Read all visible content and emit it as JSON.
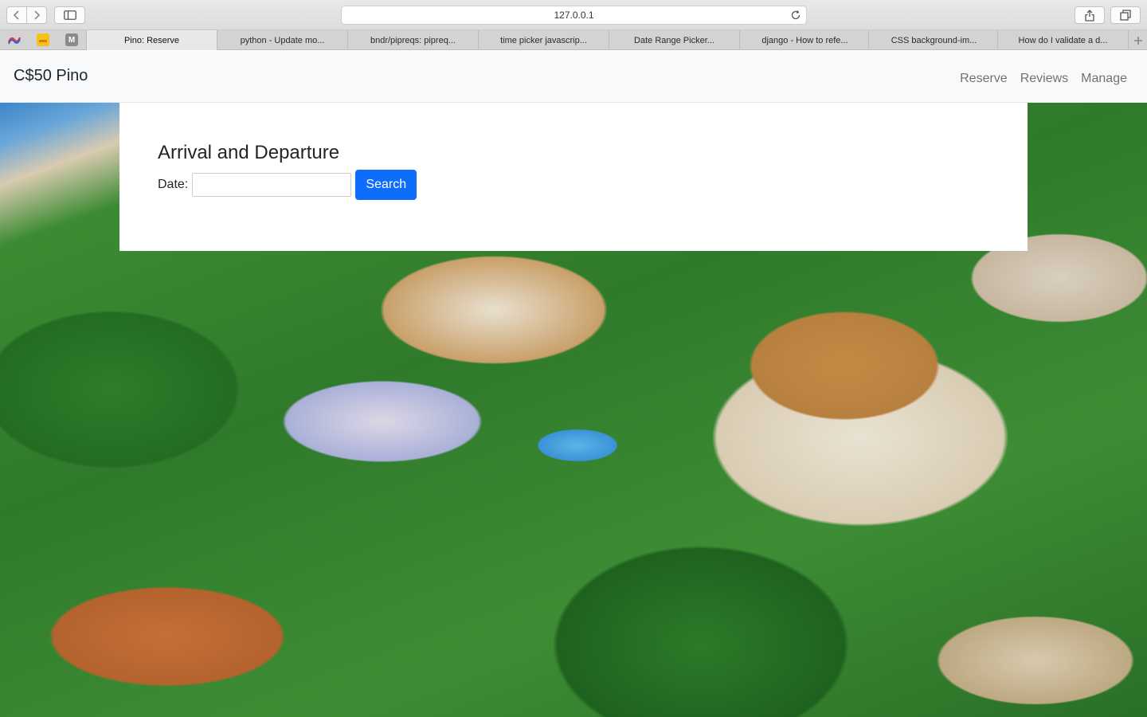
{
  "browser": {
    "url": "127.0.0.1",
    "tabs": [
      {
        "label": "Pino: Reserve",
        "active": true
      },
      {
        "label": "python - Update mo...",
        "active": false
      },
      {
        "label": "bndr/pipreqs: pipreq...",
        "active": false
      },
      {
        "label": "time picker javascrip...",
        "active": false
      },
      {
        "label": "Date Range Picker...",
        "active": false
      },
      {
        "label": "django - How to refe...",
        "active": false
      },
      {
        "label": "CSS background-im...",
        "active": false
      },
      {
        "label": "How do I validate a d...",
        "active": false
      }
    ],
    "favicons": [
      {
        "icon": "rainbow-favicon-icon"
      },
      {
        "icon": "yellow-bookmark-favicon-icon"
      },
      {
        "icon": "m-favicon-icon",
        "letter": "M"
      }
    ]
  },
  "navbar": {
    "brand": "C$50 Pino",
    "links": [
      "Reserve",
      "Reviews",
      "Manage"
    ]
  },
  "reserve": {
    "heading": "Arrival and Departure",
    "date_label": "Date:",
    "date_value": "",
    "search_label": "Search"
  },
  "colors": {
    "primary_button": "#0d6efd",
    "navbar_bg": "#f8f9fa"
  }
}
